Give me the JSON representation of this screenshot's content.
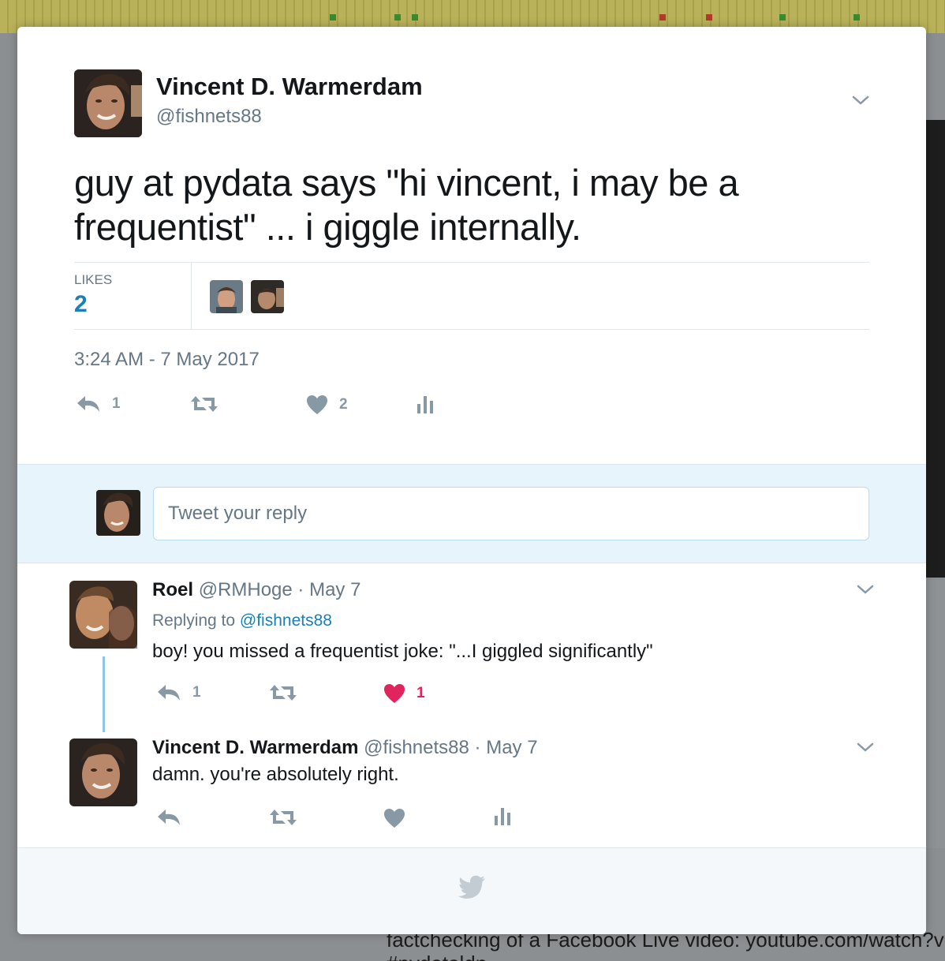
{
  "main_tweet": {
    "author_name": "Vincent D. Warmerdam",
    "author_handle": "@fishnets88",
    "text": "guy at pydata says \"hi vincent, i may be a frequentist\" ... i giggle internally.",
    "likes_label": "LIKES",
    "likes_count": "2",
    "timestamp": "3:24 AM - 7 May 2017",
    "reply_count": "1",
    "like_count": "2"
  },
  "reply_composer": {
    "placeholder": "Tweet your reply"
  },
  "replies": [
    {
      "author_name": "Roel",
      "author_handle": "@RMHoge",
      "date": "· May 7",
      "replying_prefix": "Replying to",
      "replying_to": "@fishnets88",
      "text": "boy! you missed a frequentist joke: \"...I giggled significantly\"",
      "reply_count": "1",
      "like_count": "1",
      "liked": true
    },
    {
      "author_name": "Vincent D. Warmerdam",
      "author_handle": "@fishnets88",
      "date": "· May 7",
      "text": "damn. you're absolutely right."
    }
  ],
  "background": {
    "bottom_text": "factchecking of a Facebook Live video: youtube.com/watch?v=",
    "bottom_text_2": "#pydataldn"
  },
  "colors": {
    "accent": "#1a80b5",
    "like_active": "#e0245e",
    "icon_gray": "#8899a6"
  },
  "icons": [
    "chevron-down-icon",
    "reply-icon",
    "retweet-icon",
    "heart-icon",
    "analytics-icon",
    "twitter-bird-icon"
  ]
}
